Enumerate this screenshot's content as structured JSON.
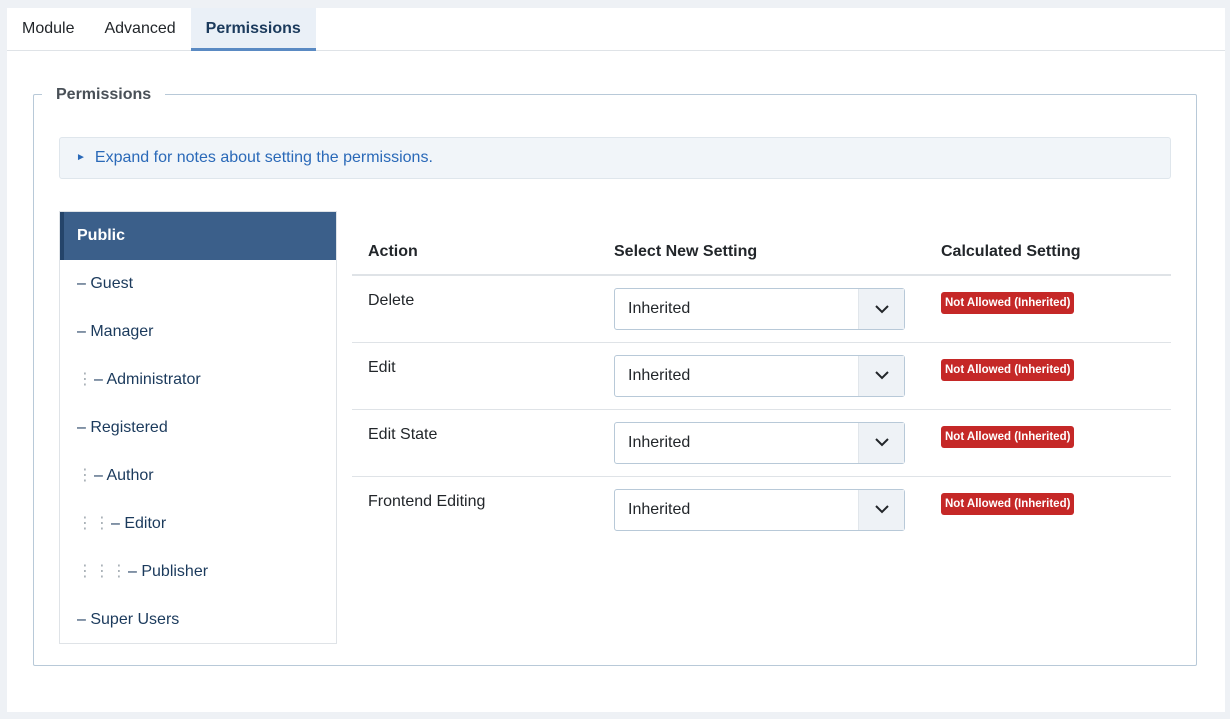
{
  "tabs": [
    {
      "label": "Module",
      "active": false
    },
    {
      "label": "Advanced",
      "active": false
    },
    {
      "label": "Permissions",
      "active": true
    }
  ],
  "fieldset": {
    "legend": "Permissions",
    "notes_toggle": "Expand for notes about setting the permissions."
  },
  "groups": [
    {
      "label": "Public",
      "depth": 0,
      "active": true
    },
    {
      "label": "– Guest",
      "depth": 0
    },
    {
      "label": "– Manager",
      "depth": 0
    },
    {
      "label": "– Administrator",
      "depth": 1
    },
    {
      "label": "– Registered",
      "depth": 0
    },
    {
      "label": "– Author",
      "depth": 1
    },
    {
      "label": "– Editor",
      "depth": 2
    },
    {
      "label": "– Publisher",
      "depth": 3
    },
    {
      "label": "– Super Users",
      "depth": 0
    }
  ],
  "table": {
    "headers": {
      "action": "Action",
      "select": "Select New Setting",
      "calculated": "Calculated Setting"
    },
    "rows": [
      {
        "action": "Delete",
        "setting": "Inherited",
        "calculated": "Not Allowed (Inherited)"
      },
      {
        "action": "Edit",
        "setting": "Inherited",
        "calculated": "Not Allowed (Inherited)"
      },
      {
        "action": "Edit State",
        "setting": "Inherited",
        "calculated": "Not Allowed (Inherited)"
      },
      {
        "action": "Frontend Editing",
        "setting": "Inherited",
        "calculated": "Not Allowed (Inherited)"
      }
    ]
  },
  "icons": {
    "notes_toggle": "triangle-right-icon",
    "select_caret": "chevron-down-icon",
    "tree_indent": "vertical-dots-icon"
  },
  "colors": {
    "active_group_bg": "#3b5f8a",
    "link": "#2a69b8",
    "badge_danger": "#c52827",
    "active_tab_border": "#5a8ac3"
  }
}
